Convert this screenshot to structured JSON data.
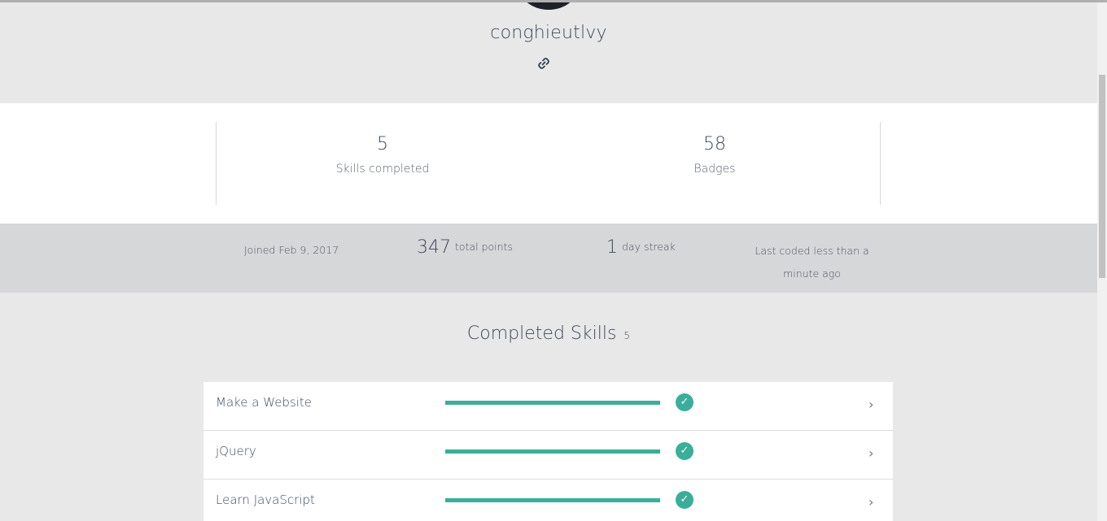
{
  "profile": {
    "username": "conghieutlvy",
    "link_icon": "link-icon"
  },
  "stats": {
    "skills_completed": {
      "value": "5",
      "label": "Skills completed"
    },
    "badges": {
      "value": "58",
      "label": "Badges"
    }
  },
  "info": {
    "joined": "Joined Feb 9, 2017",
    "points_value": "347",
    "points_label": "total points",
    "streak_value": "1",
    "streak_label": "day streak",
    "last_coded": "Last coded less than a minute ago"
  },
  "skills": {
    "title": "Completed Skills",
    "count": "5",
    "items": [
      {
        "name": "Make a Website",
        "progress": 1.0,
        "status_icon": "check-circle-icon"
      },
      {
        "name": "jQuery",
        "progress": 1.0,
        "status_icon": "check-circle-icon"
      },
      {
        "name": "Learn JavaScript",
        "progress": 1.0,
        "status_icon": "check-circle-icon"
      }
    ]
  },
  "colors": {
    "accent": "#3aae99",
    "text": "#3e4a5a",
    "header_bg": "#e8e8e8",
    "info_bg": "#d6d7d9"
  }
}
